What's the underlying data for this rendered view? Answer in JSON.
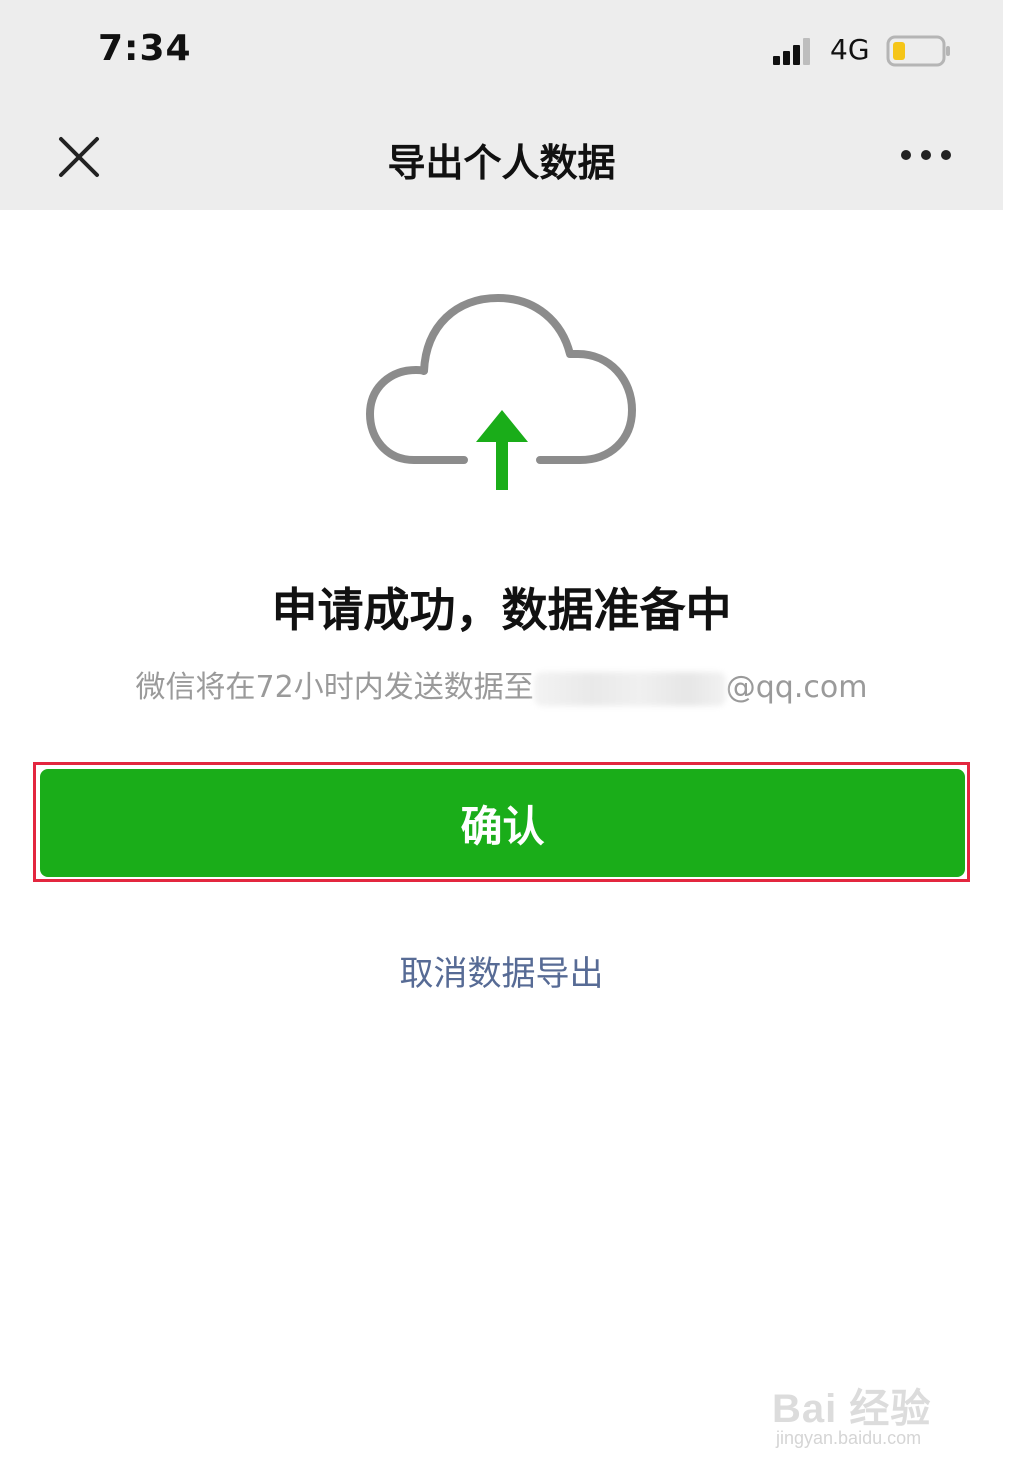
{
  "status_bar": {
    "time": "7:34",
    "network": "4G",
    "icons": [
      "signal-icon",
      "battery-icon"
    ],
    "battery_color": "#f5c518"
  },
  "nav": {
    "title": "导出个人数据",
    "left_icon": "close-icon",
    "right_icon": "more-icon"
  },
  "content": {
    "icon": "cloud-upload-icon",
    "title": "申请成功，数据准备中",
    "subtitle_prefix": "微信将在72小时内发送数据至",
    "email_suffix": "@qq.com"
  },
  "actions": {
    "confirm_label": "确认",
    "cancel_label": "取消数据导出"
  },
  "watermark": {
    "brand": "Bai 经验",
    "url": "jingyan.baidu.com"
  },
  "colors": {
    "nav_background": "#ededed",
    "primary_green": "#1aad19",
    "link_blue": "#576b95",
    "highlight_red": "#e3263f",
    "cloud_gray": "#8c8c8c"
  }
}
